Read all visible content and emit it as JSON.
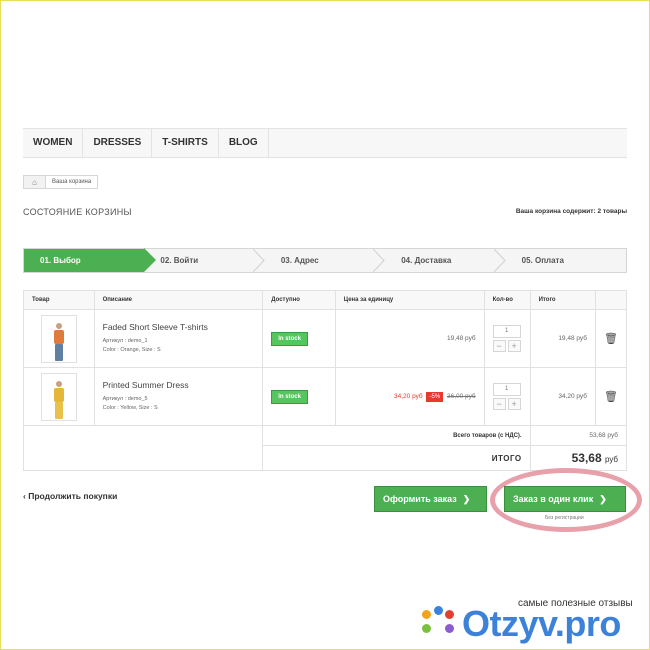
{
  "nav": {
    "items": [
      "WOMEN",
      "DRESSES",
      "T-SHIRTS",
      "BLOG"
    ]
  },
  "breadcrumb": {
    "current": "Ваша корзина"
  },
  "page": {
    "title": "Состояние корзины",
    "cart_count": "Ваша корзина содержит: 2 товары"
  },
  "steps": [
    "01. Выбор",
    "02. Войти",
    "03. Адрес",
    "04. Доставка",
    "05. Оплата"
  ],
  "table": {
    "headers": [
      "Товар",
      "Описание",
      "Доступно",
      "Цена за единицу",
      "Кол-во",
      "Итого"
    ],
    "rows": [
      {
        "name": "Faded Short Sleeve T-shirts",
        "sku": "Артикул : demo_1",
        "attrs": "Color : Orange, Size : S",
        "stock": "In stock",
        "price": "19,48 руб",
        "qty": "1",
        "total": "19,48 руб"
      },
      {
        "name": "Printed Summer Dress",
        "sku": "Артикул : demo_5",
        "attrs": "Color : Yellow, Size : S",
        "stock": "In stock",
        "price": "34,20 руб",
        "discount": "-5%",
        "old_price": "36,00 руб",
        "qty": "1",
        "total": "34,20 руб"
      }
    ],
    "subtotal_label": "Всего товаров (с НДС).",
    "subtotal": "53,68 руб",
    "grand_label": "ИТОГО",
    "grand_value": "53,68",
    "grand_currency": "руб"
  },
  "actions": {
    "continue": "Продолжить покупки",
    "order": "Оформить заказ",
    "one_click": "Заказ в один клик",
    "no_registration": "Без регистрации"
  },
  "watermark": {
    "tagline": "самые полезные отзывы",
    "brand": "Otzyv.pro"
  },
  "colors": {
    "accent": "#4cb052",
    "discount": "#e63a2f",
    "highlight_ring": "#e8a0ab",
    "brand": "#3c82d8"
  }
}
